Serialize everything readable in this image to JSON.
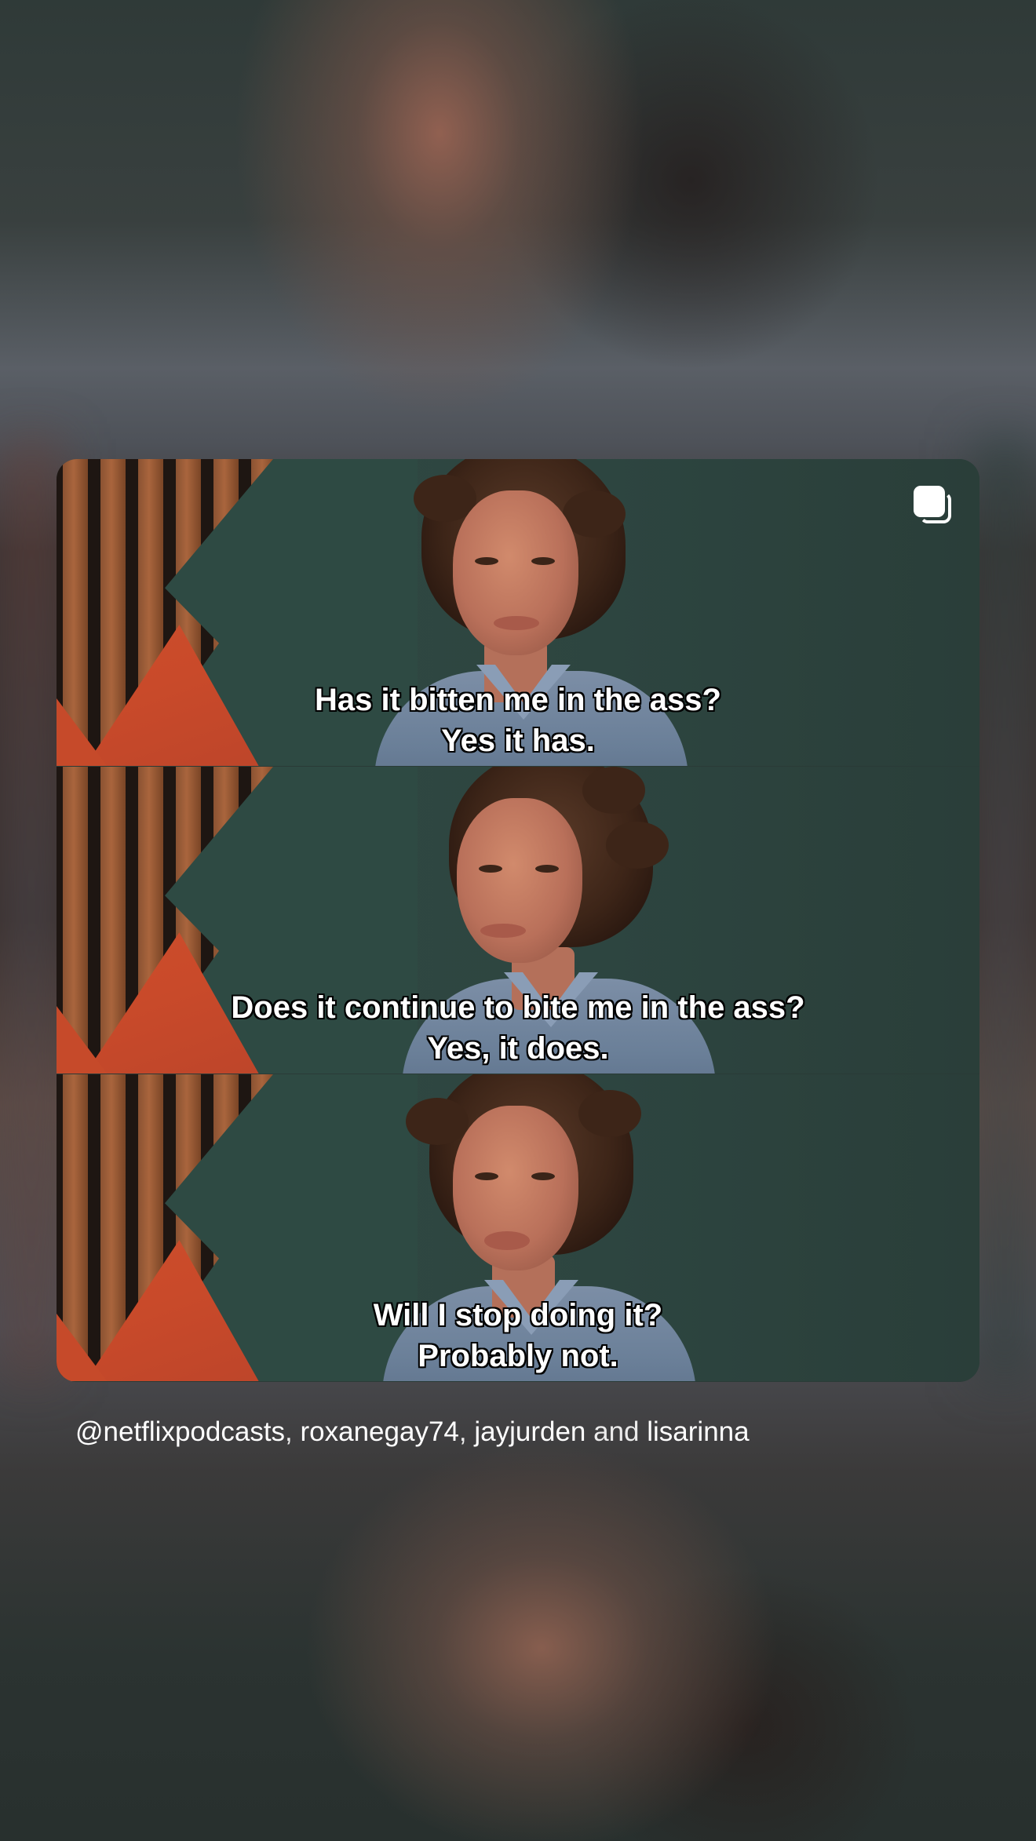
{
  "post": {
    "frames": [
      {
        "subtitle_line1": "Has it bitten me in the ass?",
        "subtitle_line2": "Yes it has."
      },
      {
        "subtitle_line1": "Does it continue to bite me in the ass?",
        "subtitle_line2": "Yes, it does."
      },
      {
        "subtitle_line1": "Will I stop doing it?",
        "subtitle_line2": "Probably not."
      }
    ],
    "multi_icon": "multiple-images-icon"
  },
  "caption": {
    "users": [
      "@netflixpodcasts",
      "roxanegay74",
      "jayjurden",
      "lisarinna"
    ],
    "sep_comma": ", ",
    "sep_and": " and "
  },
  "colors": {
    "background": "#2b3432",
    "text": "#ffffff",
    "wall_orange": "#d2532f",
    "wall_teal": "#2e4a43"
  }
}
